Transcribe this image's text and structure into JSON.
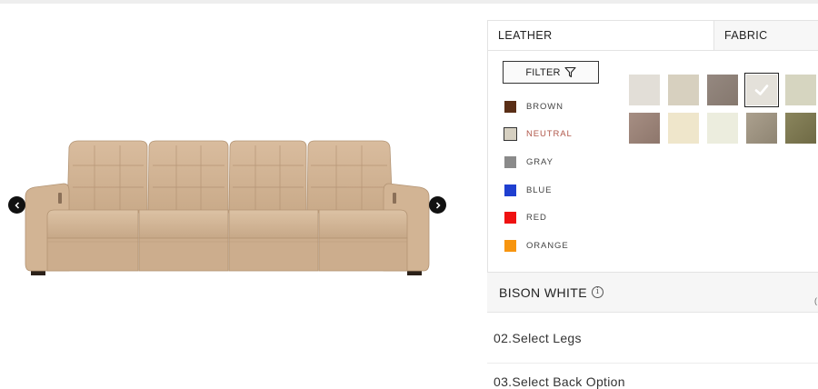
{
  "product": {
    "image": "leather-sofa-beige"
  },
  "navigation": {
    "prev_icon": "chevron-left-icon",
    "next_icon": "chevron-right-icon"
  },
  "material_tabs": [
    {
      "label": "LEATHER",
      "active": true
    },
    {
      "label": "FABRIC",
      "active": false
    }
  ],
  "filter": {
    "label": "FILTER",
    "icon": "funnel-icon"
  },
  "color_filters": [
    {
      "label": "BROWN",
      "color": "#5a2e16",
      "selected": false
    },
    {
      "label": "NEUTRAL",
      "color": "#d6d0c1",
      "selected": true
    },
    {
      "label": "GRAY",
      "color": "#8a8a8a",
      "selected": false
    },
    {
      "label": "BLUE",
      "color": "#1f3fd0",
      "selected": false
    },
    {
      "label": "RED",
      "color": "#ef1111",
      "selected": false
    },
    {
      "label": "ORANGE",
      "color": "#f7950f",
      "selected": false
    }
  ],
  "swatches": [
    {
      "color": "#e2ded7",
      "selected": false
    },
    {
      "color": "#d7d0bf",
      "selected": false
    },
    {
      "color": "#8f8278",
      "selected": false
    },
    {
      "color": "#e4e1da",
      "selected": true
    },
    {
      "color": "#d6d5c0",
      "selected": false
    },
    {
      "color": "#9b8479",
      "selected": false
    },
    {
      "color": "#efe6cb",
      "selected": false
    },
    {
      "color": "#ecedde",
      "selected": false
    },
    {
      "color": "#9f9583",
      "selected": false
    },
    {
      "color": "#7f7a52",
      "selected": false
    }
  ],
  "selection": {
    "name": "BISON WHITE",
    "info_icon": "info-icon"
  },
  "steps": {
    "legs": "02.Select Legs",
    "back": "03.Select Back Option"
  },
  "colors": {
    "active_filter_text": "#b0574a",
    "leather": "#d4b596"
  }
}
